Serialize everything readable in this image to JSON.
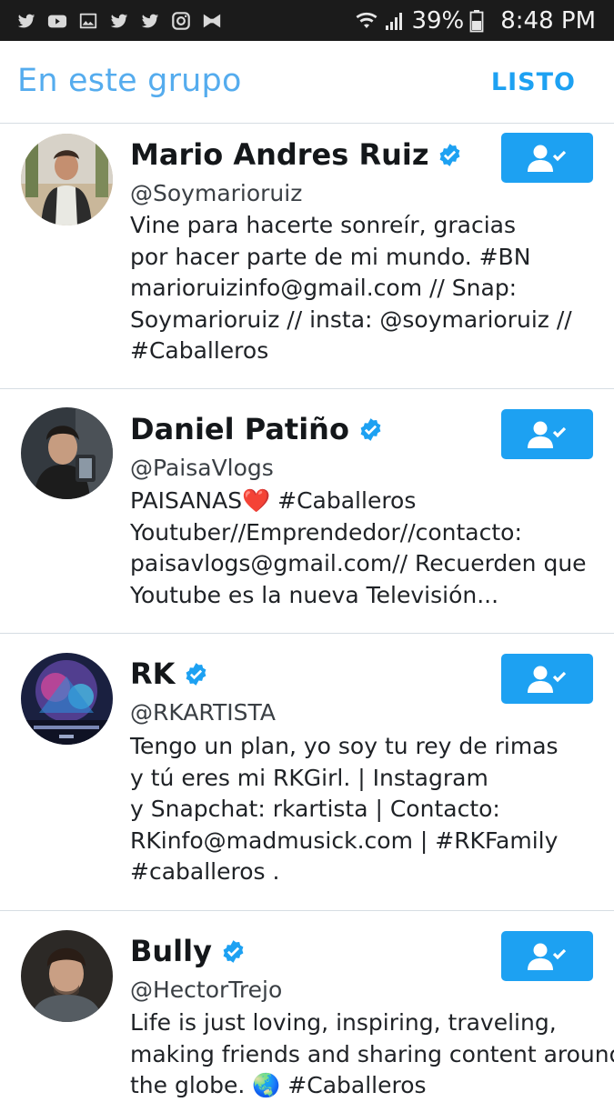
{
  "status_bar": {
    "left_icons": [
      "twitter-icon",
      "youtube-icon",
      "gallery-icon",
      "twitter-icon",
      "twitter-icon",
      "instagram-icon",
      "bowtie-icon"
    ],
    "wifi_icon": "wifi-icon",
    "signal_icon": "signal-icon",
    "battery_percent": "39%",
    "battery_icon": "battery-icon",
    "time": "8:48 PM"
  },
  "header": {
    "title": "En este grupo",
    "done_label": "LISTO"
  },
  "colors": {
    "accent": "#1da1f2",
    "title_blue": "#55acee",
    "statusbar_bg": "#1b1b1b",
    "divider": "#d6dde3"
  },
  "users": [
    {
      "name": "Mario Andres Ruiz",
      "verified": true,
      "handle": "@Soymarioruiz",
      "bio": [
        "Vine para hacerte sonreír, gracias",
        "por hacer parte de mi mundo. #BN",
        "marioruizinfo@gmail.com // Snap:",
        "Soymarioruiz // insta: @soymarioruiz //",
        "#Caballeros"
      ],
      "following": true
    },
    {
      "name": "Daniel Patiño",
      "verified": true,
      "handle": "@PaisaVlogs",
      "bio": [
        "PAISANAS❤️ #Caballeros",
        "Youtuber//Emprendedor//contacto:",
        "paisavlogs@gmail.com// Recuerden que",
        "Youtube es la nueva Televisión..."
      ],
      "following": true
    },
    {
      "name": "RK",
      "verified": true,
      "handle": "@RKARTISTA",
      "bio": [
        "Tengo un plan, yo soy tu rey de rimas",
        "y tú eres mi RKGirl. | Instagram",
        "y Snapchat: rkartista | Contacto:",
        "RKinfo@madmusick.com | #RKFamily",
        "#caballeros ."
      ],
      "following": true
    },
    {
      "name": "Bully",
      "verified": true,
      "handle": "@HectorTrejo",
      "bio": [
        "Life is just loving, inspiring, traveling,",
        "making friends and sharing content around",
        "the globe. 🌏 #Caballeros"
      ],
      "following": true
    }
  ]
}
